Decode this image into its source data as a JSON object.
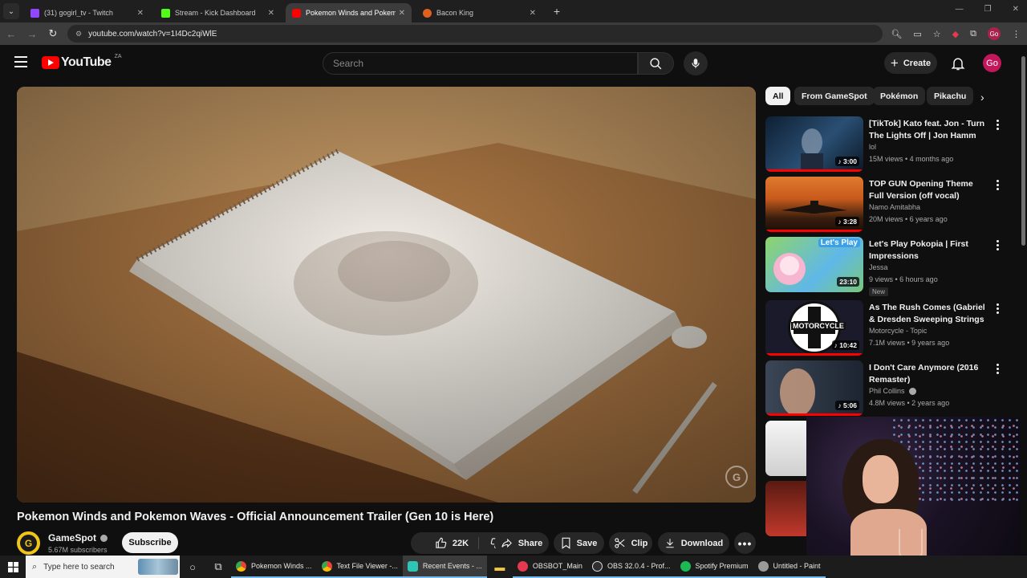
{
  "browser": {
    "tabs": [
      {
        "title": "(31) gogirl_tv - Twitch",
        "color": "#9146ff",
        "active": false
      },
      {
        "title": "Stream - Kick Dashboard",
        "color": "#53fc18",
        "active": false
      },
      {
        "title": "Pokemon Winds and Pokemon",
        "color": "#ff0000",
        "active": true
      },
      {
        "title": "Bacon King",
        "color": "#e0601f",
        "active": false
      }
    ],
    "url": "youtube.com/watch?v=1I4Dc2qiWlE",
    "profile_initials": "Go"
  },
  "masthead": {
    "logo_text": "YouTube",
    "region": "ZA",
    "search_placeholder": "Search",
    "create_label": "Create",
    "avatar_initials": "Go"
  },
  "video": {
    "title": "Pokemon Winds and Pokemon Waves - Official Announcement Trailer (Gen 10 is Here)",
    "watermark": "G",
    "channel": {
      "name": "GameSpot",
      "subscribers": "5.67M subscribers",
      "avatar_letter": "G"
    },
    "subscribe_label": "Subscribe",
    "likes": "22K",
    "share_label": "Share",
    "save_label": "Save",
    "clip_label": "Clip",
    "download_label": "Download"
  },
  "chips": [
    "All",
    "From GameSpot",
    "Pokémon",
    "Pikachu"
  ],
  "recommendations": [
    {
      "title": "[TikTok] Kato feat. Jon - Turn The Lights Off | Jon Hamm",
      "channel": "lol",
      "meta": "15M views • 4 months ago",
      "duration": "3:00",
      "badge": ""
    },
    {
      "title": "TOP GUN Opening Theme Full Version (off vocal)",
      "channel": "Namo Amitabha",
      "meta": "20M views • 6 years ago",
      "duration": "3:28",
      "badge": ""
    },
    {
      "title": "Let's Play Pokopia | First Impressions",
      "channel": "Jessa",
      "meta": "9 views • 6 hours ago",
      "duration": "23:10",
      "badge": "New",
      "thumb_text": "Let's Play"
    },
    {
      "title": "As The Rush Comes (Gabriel & Dresden Sweeping Strings ...",
      "channel": "Motorcycle - Topic",
      "meta": "7.1M views • 9 years ago",
      "duration": "10:42",
      "badge": "",
      "thumb_text": "MOTORCYCLE"
    },
    {
      "title": "I Don't Care Anymore (2016 Remaster)",
      "channel": "Phil Collins",
      "meta": "4.8M views • 2 years ago",
      "duration": "5:06",
      "badge": ""
    }
  ],
  "taskbar": {
    "search_placeholder": "Type here to search",
    "items": [
      {
        "label": "Pokemon Winds ...",
        "color": "#4285f4",
        "state": "open"
      },
      {
        "label": "Text File Viewer -...",
        "color": "#4285f4",
        "state": "open"
      },
      {
        "label": "Recent Events - ...",
        "color": "#2ec4b6",
        "state": "focus"
      },
      {
        "label": "OBSBOT_Main",
        "color": "#e53950",
        "state": "open"
      },
      {
        "label": "OBS 32.0.4 - Prof...",
        "color": "#302e31",
        "state": "open"
      },
      {
        "label": "Spotify Premium",
        "color": "#1db954",
        "state": "open"
      },
      {
        "label": "Untitled - Paint",
        "color": "#7f7f7f",
        "state": "open"
      }
    ]
  }
}
